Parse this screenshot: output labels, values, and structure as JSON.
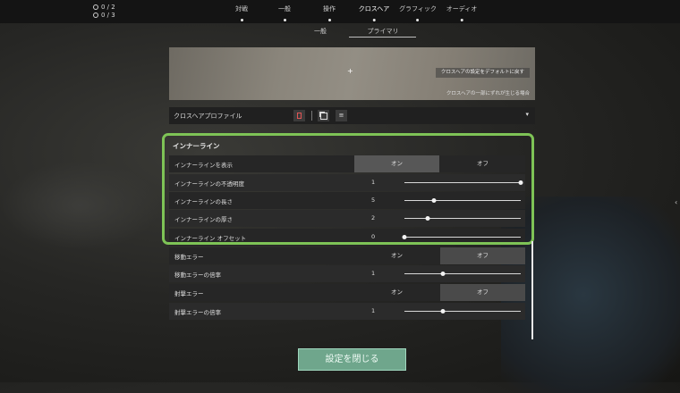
{
  "colors": {
    "accent_highlight": "#7ec356",
    "close_button": "#6fa68c"
  },
  "status": {
    "counter1": "0 / 2",
    "counter2": "0 / 3"
  },
  "tabs": [
    {
      "label": "対戦"
    },
    {
      "label": "一般"
    },
    {
      "label": "操作"
    },
    {
      "label": "クロスヘア"
    },
    {
      "label": "グラフィック"
    },
    {
      "label": "オーディオ"
    }
  ],
  "subtabs": [
    {
      "label": "一般"
    },
    {
      "label": "プライマリ"
    }
  ],
  "preview": {
    "reset_label": "クロスヘアの設定をデフォルトに戻す",
    "note": "クロスヘアの一部にずれが生じる場合"
  },
  "profile": {
    "label": "クロスヘアプロファイル",
    "selected": "",
    "delete_icon": "trash-icon",
    "copy_icon": "copy-icon",
    "import_icon": "import-icon"
  },
  "inner_lines": {
    "title": "インナーライン",
    "show_label": "インナーラインを表示",
    "on_label": "オン",
    "off_label": "オフ",
    "opacity": {
      "label": "インナーラインの不透明度",
      "value": "1",
      "fraction": 1.0
    },
    "length": {
      "label": "インナーラインの長さ",
      "value": "5",
      "fraction": 0.25
    },
    "thickness": {
      "label": "インナーラインの厚さ",
      "value": "2",
      "fraction": 0.2
    },
    "offset": {
      "label": "インナーライン オフセット",
      "value": "0",
      "fraction": 0.0
    }
  },
  "movement_error": {
    "label": "移動エラー",
    "on_label": "オン",
    "off_label": "オフ",
    "multiplier": {
      "label": "移動エラーの倍率",
      "value": "1",
      "fraction": 0.33
    }
  },
  "firing_error": {
    "label": "射撃エラー",
    "on_label": "オン",
    "off_label": "オフ",
    "multiplier": {
      "label": "射撃エラーの倍率",
      "value": "1",
      "fraction": 0.33
    }
  },
  "close_button": "設定を閉じる"
}
